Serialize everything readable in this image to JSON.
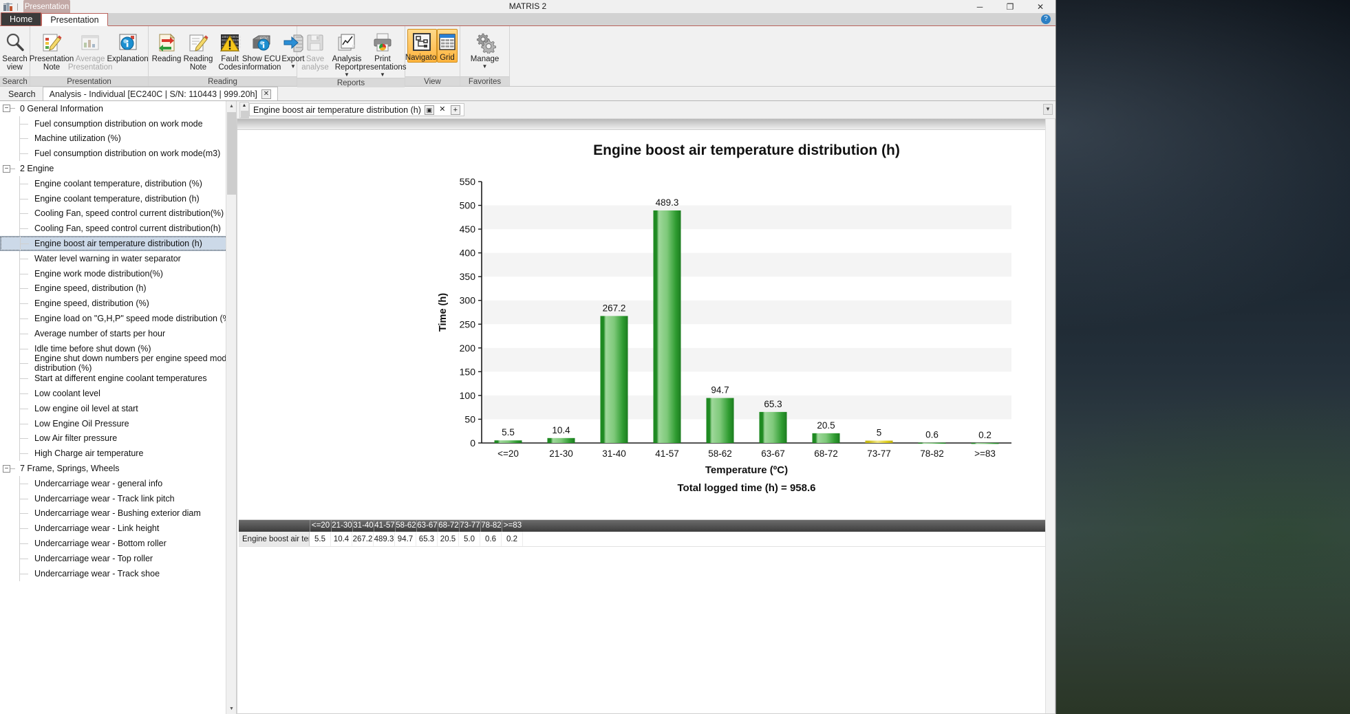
{
  "window": {
    "title": "MATRIS 2",
    "floating_tab": "Presentation",
    "minimize": "─",
    "maximize": "❐",
    "close": "✕",
    "help": "?"
  },
  "ribbon": {
    "tabs": [
      {
        "label": "Home",
        "active": false
      },
      {
        "label": "Presentation",
        "active": true
      }
    ],
    "groups": [
      {
        "name": "Search",
        "label": "Search",
        "items": [
          {
            "label": "Search\nview",
            "icon": "magnifier-icon",
            "disabled": false,
            "caret": false,
            "toggled": false
          }
        ]
      },
      {
        "name": "Presentation",
        "label": "Presentation",
        "items": [
          {
            "label": "Presentation\nNote",
            "icon": "note-pencil-icon",
            "disabled": false,
            "caret": false,
            "toggled": false
          },
          {
            "label": "Average\nPresentation",
            "icon": "average-chart-icon",
            "disabled": true,
            "caret": false,
            "toggled": false
          },
          {
            "label": "Explanation",
            "icon": "explanation-icon",
            "disabled": false,
            "caret": false,
            "toggled": false
          }
        ]
      },
      {
        "name": "Reading",
        "label": "Reading",
        "items": [
          {
            "label": "Reading",
            "icon": "reading-arrows-icon",
            "disabled": false,
            "caret": false,
            "toggled": false
          },
          {
            "label": "Reading\nNote",
            "icon": "reading-note-icon",
            "disabled": false,
            "caret": false,
            "toggled": false
          },
          {
            "label": "Fault\nCodes",
            "icon": "fault-codes-warning-icon",
            "disabled": false,
            "caret": false,
            "toggled": false
          },
          {
            "label": "Show ECU\ninformation",
            "icon": "ecu-info-icon",
            "disabled": false,
            "caret": false,
            "toggled": false
          },
          {
            "label": "Export",
            "icon": "export-icon",
            "disabled": false,
            "caret": true,
            "toggled": false
          }
        ]
      },
      {
        "name": "Reports",
        "label": "Reports",
        "items": [
          {
            "label": "Save\nanalyse",
            "icon": "save-floppy-icon",
            "disabled": true,
            "caret": false,
            "toggled": false
          },
          {
            "label": "Analysis\nReport",
            "icon": "analysis-report-icon",
            "disabled": false,
            "caret": true,
            "toggled": false
          },
          {
            "label": "Print\npresentations",
            "icon": "printer-icon",
            "disabled": false,
            "caret": true,
            "toggled": false
          }
        ]
      },
      {
        "name": "View",
        "label": "View",
        "items": [
          {
            "label": "Navigator",
            "icon": "navigator-icon",
            "disabled": false,
            "caret": false,
            "toggled": true
          },
          {
            "label": "Grid",
            "icon": "grid-table-icon",
            "disabled": false,
            "caret": false,
            "toggled": true
          }
        ]
      },
      {
        "name": "Favorites",
        "label": "Favorites",
        "items": [
          {
            "label": "Manage",
            "icon": "gears-icon",
            "disabled": false,
            "caret": true,
            "toggled": false
          }
        ]
      }
    ]
  },
  "doctabs": {
    "search_label": "Search",
    "analysis_label": "Analysis - Individual [EC240C | S/N: 110443 | 999.20h]",
    "close_glyph": "✕"
  },
  "tree": {
    "nodes": [
      {
        "type": "group",
        "label": "0 General Information",
        "expander": "−"
      },
      {
        "type": "leaf",
        "label": "Fuel consumption distribution on work mode"
      },
      {
        "type": "leaf",
        "label": "Machine utilization (%)"
      },
      {
        "type": "leaf",
        "label": "Fuel consumption distribution on work mode(m3)"
      },
      {
        "type": "group",
        "label": "2 Engine",
        "expander": "−"
      },
      {
        "type": "leaf",
        "label": "Engine coolant temperature, distribution (%)"
      },
      {
        "type": "leaf",
        "label": "Engine coolant temperature, distribution (h)"
      },
      {
        "type": "leaf",
        "label": "Cooling Fan, speed control current distribution(%)"
      },
      {
        "type": "leaf",
        "label": "Cooling Fan, speed control current distribution(h)"
      },
      {
        "type": "leaf",
        "label": "Engine boost air temperature distribution (h)",
        "selected": true
      },
      {
        "type": "leaf",
        "label": "Water level warning in water separator"
      },
      {
        "type": "leaf",
        "label": "Engine work mode distribution(%)"
      },
      {
        "type": "leaf",
        "label": "Engine speed, distribution (h)"
      },
      {
        "type": "leaf",
        "label": "Engine speed, distribution (%)"
      },
      {
        "type": "leaf",
        "label": "Engine load on \"G,H,P\" speed mode distribution (%)"
      },
      {
        "type": "leaf",
        "label": "Average number of starts per hour"
      },
      {
        "type": "leaf",
        "label": "Idle time before shut down (%)"
      },
      {
        "type": "leaf",
        "label": "Engine shut down numbers per engine speed mode distribution (%)"
      },
      {
        "type": "leaf",
        "label": "Start at different engine coolant temperatures"
      },
      {
        "type": "leaf",
        "label": "Low coolant level"
      },
      {
        "type": "leaf",
        "label": "Low engine oil level at start"
      },
      {
        "type": "leaf",
        "label": "Low Engine Oil Pressure"
      },
      {
        "type": "leaf",
        "label": "Low Air filter pressure"
      },
      {
        "type": "leaf",
        "label": "High Charge air temperature"
      },
      {
        "type": "group",
        "label": "7 Frame, Springs, Wheels",
        "expander": "−"
      },
      {
        "type": "leaf",
        "label": "Undercarriage wear - general info"
      },
      {
        "type": "leaf",
        "label": "Undercarriage wear - Track link pitch"
      },
      {
        "type": "leaf",
        "label": "Undercarriage wear - Bushing exterior diam"
      },
      {
        "type": "leaf",
        "label": "Undercarriage wear - Link height"
      },
      {
        "type": "leaf",
        "label": "Undercarriage wear - Bottom roller"
      },
      {
        "type": "leaf",
        "label": "Undercarriage wear - Top roller"
      },
      {
        "type": "leaf",
        "label": "Undercarriage wear - Track shoe"
      }
    ]
  },
  "presentation_pane": {
    "tab_title": "Engine boost air temperature distribution (h)",
    "restore_glyph": "▣",
    "close_glyph": "✕",
    "add_glyph": "+",
    "panel_close_glyph": "✕"
  },
  "chart_data": {
    "type": "bar",
    "title": "Engine boost air temperature distribution (h)",
    "xlabel": "Temperature (ºC)",
    "ylabel": "Time (h)",
    "categories": [
      "<=20",
      "21-30",
      "31-40",
      "41-57",
      "58-62",
      "63-67",
      "68-72",
      "73-77",
      "78-82",
      ">=83"
    ],
    "values": [
      5.5,
      10.4,
      267.2,
      489.3,
      94.7,
      65.3,
      20.5,
      5,
      0.6,
      0.2
    ],
    "value_labels": [
      "5.5",
      "10.4",
      "267.2",
      "489.3",
      "94.7",
      "65.3",
      "20.5",
      "5",
      "0.6",
      "0.2"
    ],
    "bar_colors": [
      "#2e9b30",
      "#2e9b30",
      "#2e9b30",
      "#2e9b30",
      "#2e9b30",
      "#2e9b30",
      "#2e9b30",
      "#e8d83a",
      "#2e9b30",
      "#2e9b30"
    ],
    "ylim": [
      0,
      550
    ],
    "yticks": [
      0,
      50,
      100,
      150,
      200,
      250,
      300,
      350,
      400,
      450,
      500,
      550
    ],
    "grid": "alternating-bands",
    "footer": "Total logged time (h) = 958.6",
    "legend": ""
  },
  "grid": {
    "row_header": "Engine boost air tempe",
    "columns": [
      "<=20",
      "21-30",
      "31-40",
      "41-57",
      "58-62",
      "63-67",
      "68-72",
      "73-77",
      "78-82",
      ">=83"
    ],
    "values": [
      "5.5",
      "10.4",
      "267.2",
      "489.3",
      "94.7",
      "65.3",
      "20.5",
      "5.0",
      "0.6",
      "0.2"
    ]
  }
}
